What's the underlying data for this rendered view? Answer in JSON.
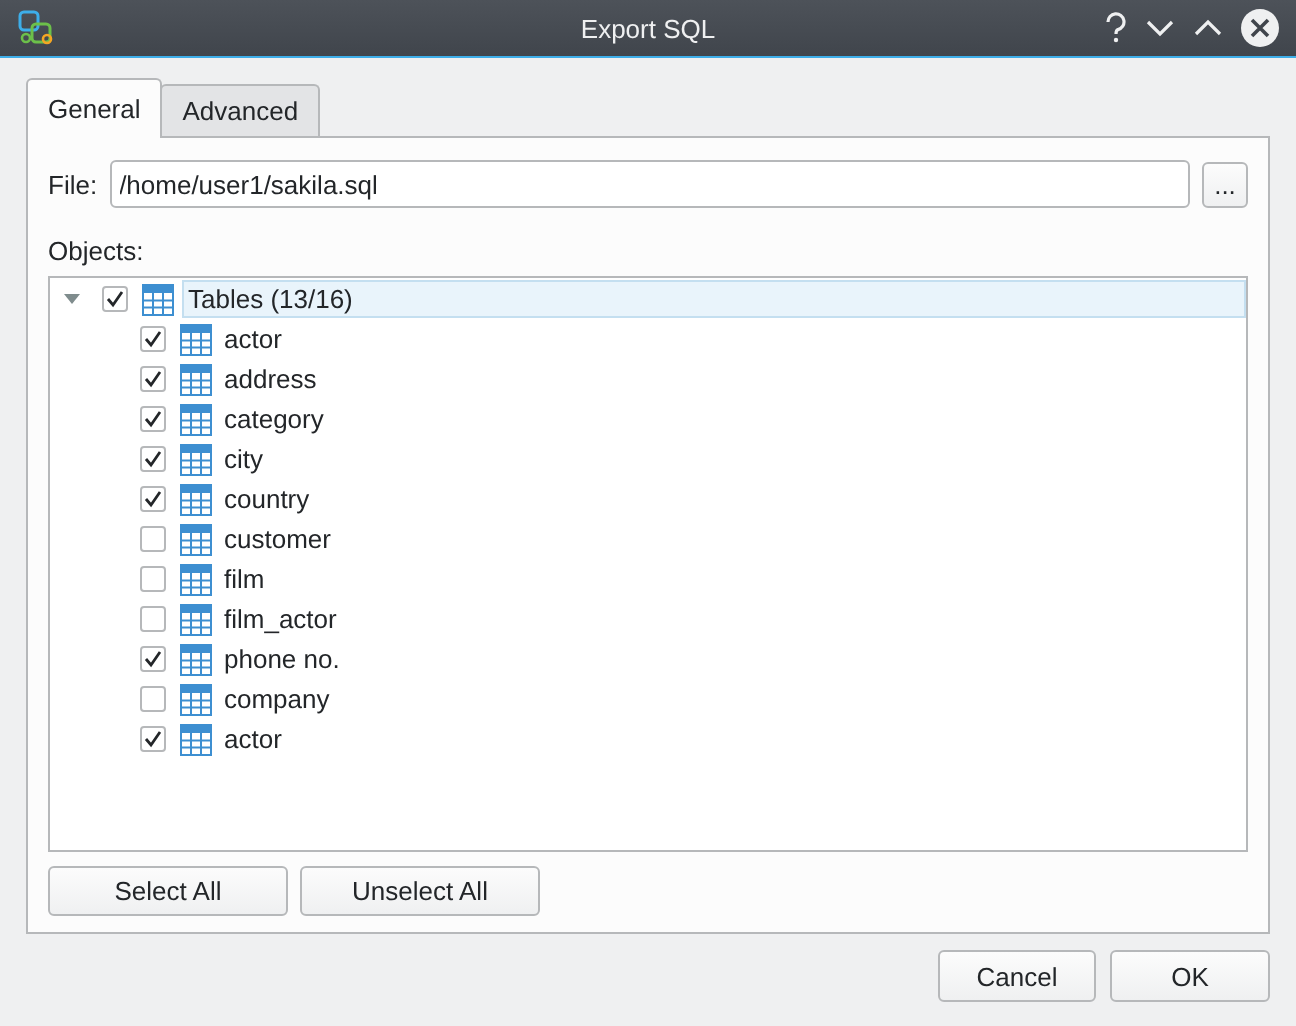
{
  "window": {
    "title": "Export SQL"
  },
  "tabs": [
    {
      "label": "General",
      "selected": true
    },
    {
      "label": "Advanced",
      "selected": false
    }
  ],
  "file": {
    "label": "File:",
    "value": "/home/user1/sakila.sql",
    "browse_button": "..."
  },
  "objects": {
    "label": "Objects:",
    "tree": [
      {
        "label": "Tables (13/16)",
        "checked": true,
        "expanded": true,
        "selected": true,
        "children": [
          {
            "label": "actor",
            "checked": true,
            "selected": false
          },
          {
            "label": "address",
            "checked": true,
            "selected": false
          },
          {
            "label": "category",
            "checked": true,
            "selected": false
          },
          {
            "label": "city",
            "checked": true,
            "selected": false
          },
          {
            "label": "country",
            "checked": true,
            "selected": false
          },
          {
            "label": "customer",
            "checked": false,
            "selected": false
          },
          {
            "label": "film",
            "checked": false,
            "selected": false
          },
          {
            "label": "film_actor",
            "checked": false,
            "selected": false
          },
          {
            "label": "phone no.",
            "checked": true,
            "selected": false
          },
          {
            "label": "company",
            "checked": false,
            "selected": false
          },
          {
            "label": "actor",
            "checked": true,
            "selected": false
          }
        ]
      }
    ]
  },
  "selection_buttons": [
    "Select All",
    "Unselect All"
  ],
  "dialog_buttons": [
    "Cancel",
    "OK"
  ]
}
